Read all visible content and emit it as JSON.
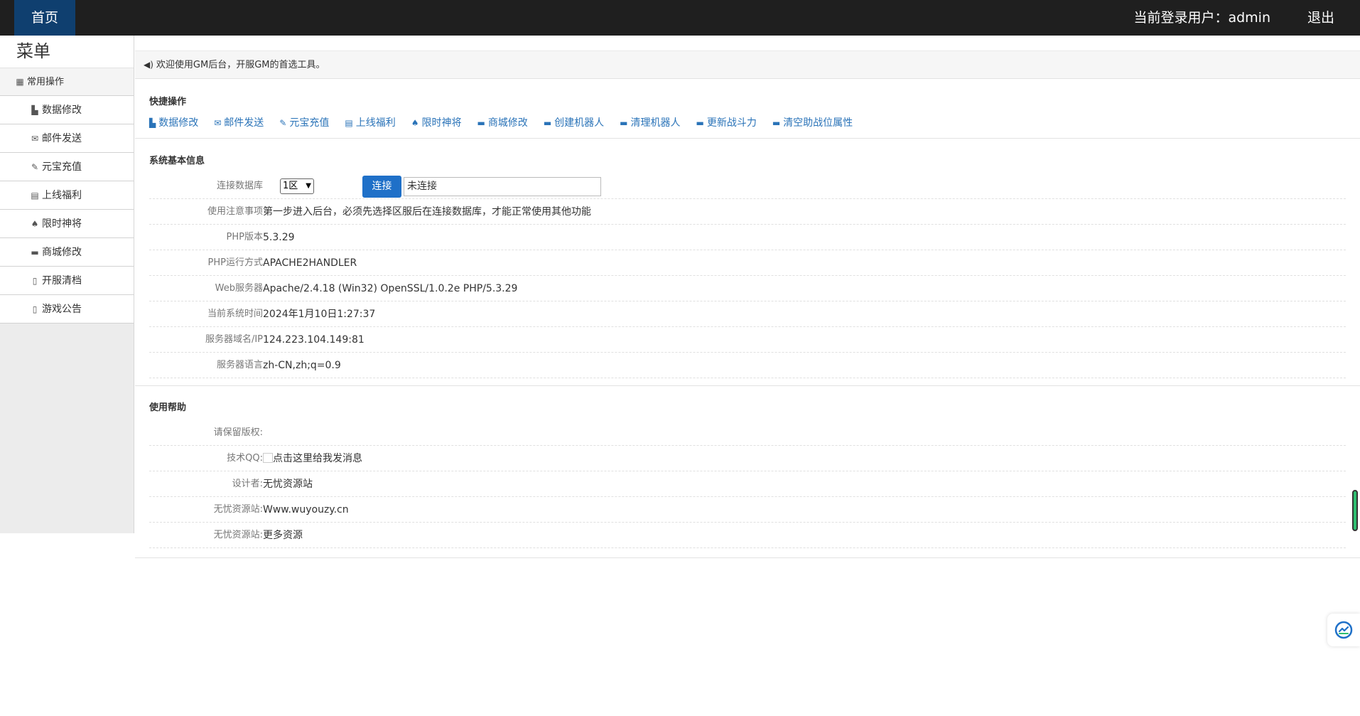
{
  "topbar": {
    "home_tab": "首页",
    "user_label": "当前登录用户：",
    "username": "admin",
    "logout": "退出"
  },
  "sidebar": {
    "title": "菜单",
    "group": {
      "label": "常用操作",
      "icon": "grid-icon"
    },
    "items": [
      {
        "label": "数据修改",
        "icon": "edit-icon"
      },
      {
        "label": "邮件发送",
        "icon": "mail-icon"
      },
      {
        "label": "元宝充值",
        "icon": "wrench-icon"
      },
      {
        "label": "上线福利",
        "icon": "list-icon"
      },
      {
        "label": "限时神将",
        "icon": "spade-icon"
      },
      {
        "label": "商城修改",
        "icon": "folder-icon"
      },
      {
        "label": "开服清档",
        "icon": "file-icon"
      },
      {
        "label": "游戏公告",
        "icon": "file-icon"
      }
    ]
  },
  "notice": {
    "text": "欢迎使用GM后台，开服GM的首选工具。",
    "icon": "speaker-icon"
  },
  "quick_ops": {
    "title": "快捷操作",
    "links": [
      {
        "label": "数据修改",
        "icon": "edit-icon"
      },
      {
        "label": "邮件发送",
        "icon": "mail-icon"
      },
      {
        "label": "元宝充值",
        "icon": "wrench-icon"
      },
      {
        "label": "上线福利",
        "icon": "list-icon"
      },
      {
        "label": "限时神将",
        "icon": "spade-icon"
      },
      {
        "label": "商城修改",
        "icon": "folder-icon"
      },
      {
        "label": "创建机器人",
        "icon": "folder-icon"
      },
      {
        "label": "清理机器人",
        "icon": "folder-icon"
      },
      {
        "label": "更新战斗力",
        "icon": "folder-icon"
      },
      {
        "label": "清空助战位属性",
        "icon": "folder-icon"
      }
    ]
  },
  "sys_info": {
    "title": "系统基本信息",
    "db_label": "连接数据库",
    "db_selected": "1区",
    "connect_button": "连接",
    "connect_status": "未连接",
    "rows": [
      {
        "label": "使用注意事项",
        "value": "第一步进入后台，必须先选择区服后在连接数据库，才能正常使用其他功能"
      },
      {
        "label": "PHP版本",
        "value": "5.3.29"
      },
      {
        "label": "PHP运行方式",
        "value": "APACHE2HANDLER"
      },
      {
        "label": "Web服务器",
        "value": "Apache/2.4.18 (Win32) OpenSSL/1.0.2e PHP/5.3.29"
      },
      {
        "label": "当前系统时间",
        "value": "2024年1月10日1:27:37"
      },
      {
        "label": "服务器域名/IP",
        "value": "124.223.104.149:81"
      },
      {
        "label": "服务器语言",
        "value": "zh-CN,zh;q=0.9"
      }
    ]
  },
  "help": {
    "title": "使用帮助",
    "rows": [
      {
        "label": "请保留版权:",
        "value": ""
      },
      {
        "label": "技术QQ:",
        "value": "点击这里给我发消息"
      },
      {
        "label": "设计者:",
        "value": "无忧资源站"
      },
      {
        "label": "无忧资源站:",
        "value": "Www.wuyouzy.cn"
      },
      {
        "label": "无忧资源站:",
        "value": "更多资源"
      }
    ]
  },
  "colors": {
    "topbar": "#1f1f1f",
    "home_tab": "#0f3f6f",
    "link": "#2a73b8",
    "button": "#1f70c8"
  }
}
